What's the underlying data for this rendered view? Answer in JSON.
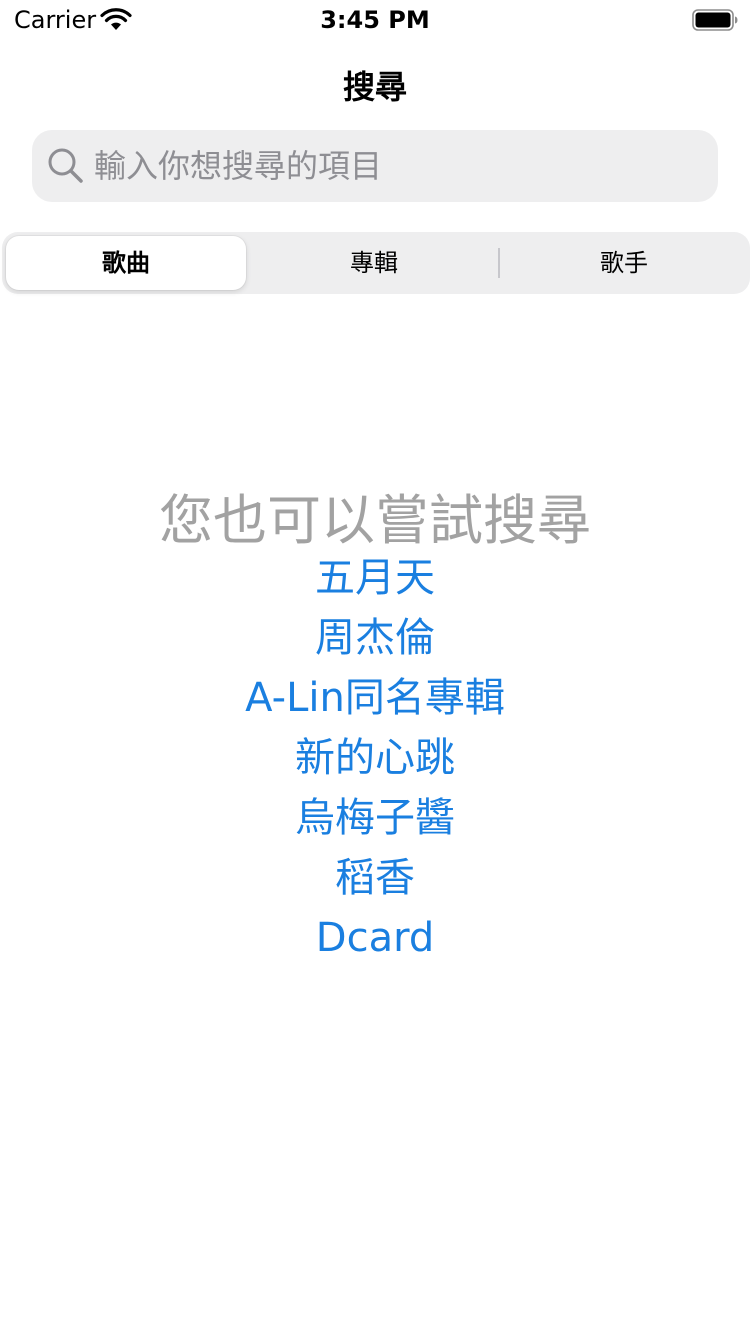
{
  "status_bar": {
    "carrier": "Carrier",
    "time": "3:45 PM",
    "wifi_icon": "wifi-icon",
    "battery_icon": "battery-icon"
  },
  "nav": {
    "title": "搜尋"
  },
  "search": {
    "placeholder": "輸入你想搜尋的項目",
    "value": "",
    "icon": "search-icon"
  },
  "segments": [
    {
      "label": "歌曲",
      "selected": true
    },
    {
      "label": "專輯",
      "selected": false
    },
    {
      "label": "歌手",
      "selected": false
    }
  ],
  "suggestions": {
    "title": "您也可以嘗試搜尋",
    "items": [
      "五月天",
      "周杰倫",
      "A-Lin同名專輯",
      "新的心跳",
      "烏梅子醬",
      "稻香",
      "Dcard"
    ]
  },
  "colors": {
    "accent": "#1a7fe0",
    "muted_text": "#a2a2a2",
    "search_bg": "#eeeeef"
  }
}
